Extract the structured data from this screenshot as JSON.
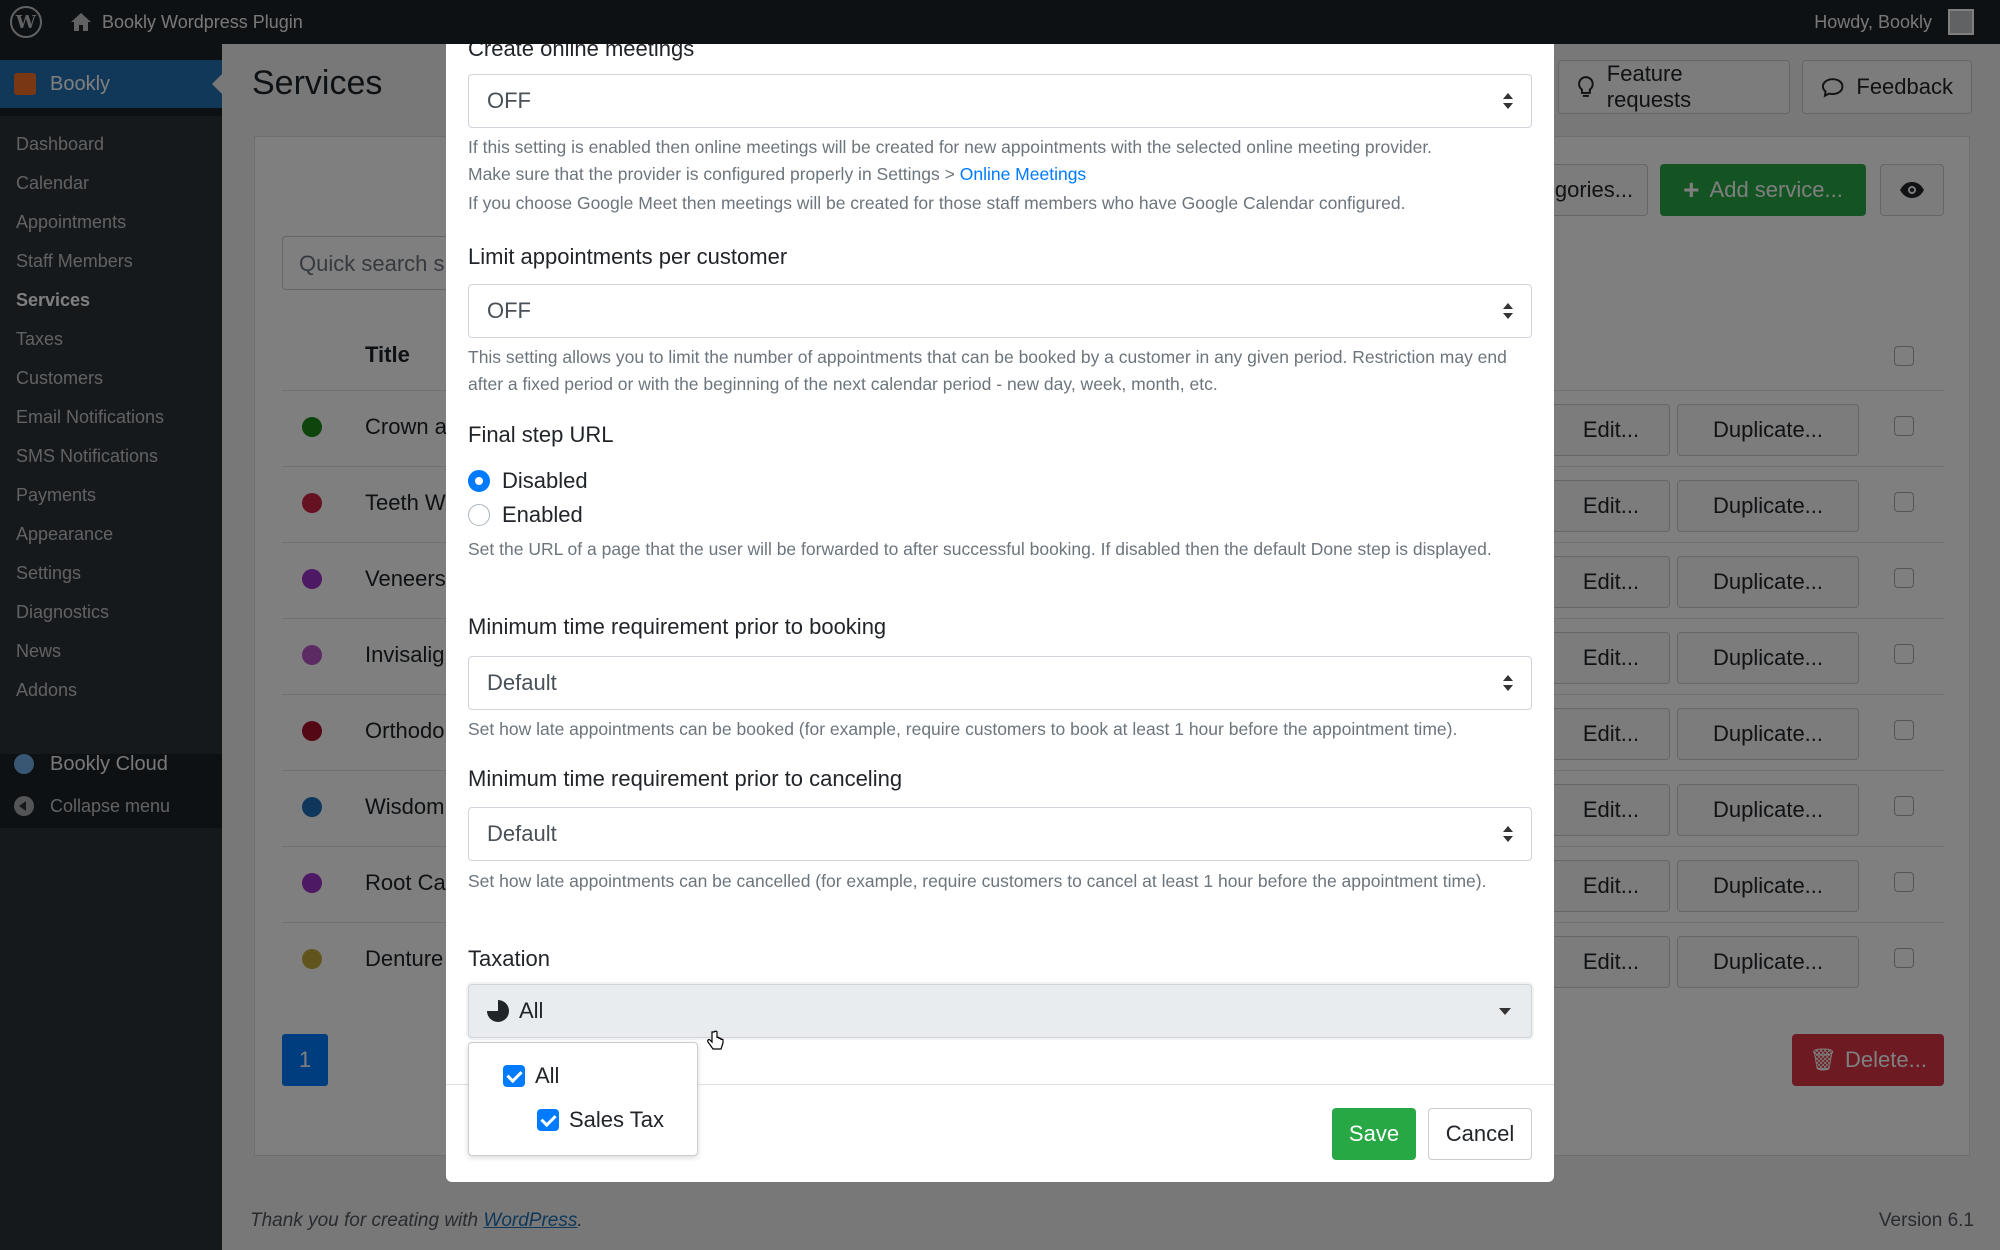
{
  "adminbar": {
    "site_name": "Bookly Wordpress Plugin",
    "howdy": "Howdy, Bookly"
  },
  "sidebar": {
    "active": "Bookly",
    "items": [
      {
        "label": "Dashboard"
      },
      {
        "label": "Calendar"
      },
      {
        "label": "Appointments"
      },
      {
        "label": "Staff Members"
      },
      {
        "label": "Services"
      },
      {
        "label": "Taxes"
      },
      {
        "label": "Customers"
      },
      {
        "label": "Email Notifications"
      },
      {
        "label": "SMS Notifications"
      },
      {
        "label": "Payments"
      },
      {
        "label": "Appearance"
      },
      {
        "label": "Settings"
      },
      {
        "label": "Diagnostics"
      },
      {
        "label": "News"
      },
      {
        "label": "Addons"
      }
    ],
    "cloud": "Bookly Cloud",
    "collapse": "Collapse menu"
  },
  "page": {
    "title": "Services",
    "feature_requests": "Feature requests",
    "feedback": "Feedback",
    "categories": "gories...",
    "add_service": "Add service...",
    "quick_search": "Quick search s",
    "col_title": "Title",
    "edit_label": "Edit...",
    "duplicate_label": "Duplicate...",
    "page_number": "1",
    "delete_label": "Delete...",
    "rows": [
      {
        "title": "Crown a",
        "color": "#1a8a1a"
      },
      {
        "title": "Teeth W",
        "color": "#cc2244"
      },
      {
        "title": "Veneers",
        "color": "#9b30c8"
      },
      {
        "title": "Invisalig",
        "color": "#b857c8"
      },
      {
        "title": "Orthodo",
        "color": "#a8102a"
      },
      {
        "title": "Wisdom",
        "color": "#1e6fb8"
      },
      {
        "title": "Root Ca",
        "color": "#9b30c8"
      },
      {
        "title": "Denture",
        "color": "#c2a838"
      }
    ]
  },
  "footer": {
    "thanks": "Thank you for creating with",
    "wp_link": "WordPress",
    "period": ".",
    "version": "Version 6.1"
  },
  "modal": {
    "online_meetings_label": "Create online meetings",
    "online_meetings_value": "OFF",
    "online_meetings_help1": "If this setting is enabled then online meetings will be created for new appointments with the selected online meeting provider.",
    "online_meetings_help2": "Make sure that the provider is configured properly in Settings > ",
    "online_meetings_link": "Online Meetings",
    "online_meetings_help3": "If you choose Google Meet then meetings will be created for those staff members who have Google Calendar configured.",
    "limit_label": "Limit appointments per customer",
    "limit_value": "OFF",
    "limit_help": "This setting allows you to limit the number of appointments that can be booked by a customer in any given period. Restriction may end after a fixed period or with the beginning of the next calendar period - new day, week, month, etc.",
    "final_url_label": "Final step URL",
    "radio_disabled": "Disabled",
    "radio_enabled": "Enabled",
    "final_url_help": "Set the URL of a page that the user will be forwarded to after successful booking. If disabled then the default Done step is displayed.",
    "min_booking_label": "Minimum time requirement prior to booking",
    "min_booking_value": "Default",
    "min_booking_help": "Set how late appointments can be booked (for example, require customers to book at least 1 hour before the appointment time).",
    "min_cancel_label": "Minimum time requirement prior to canceling",
    "min_cancel_value": "Default",
    "min_cancel_help": "Set how late appointments can be cancelled (for example, require customers to cancel at least 1 hour before the appointment time).",
    "taxation_label": "Taxation",
    "taxation_value": "All",
    "dropdown_all": "All",
    "dropdown_sales_tax": "Sales Tax",
    "save": "Save",
    "cancel": "Cancel"
  }
}
